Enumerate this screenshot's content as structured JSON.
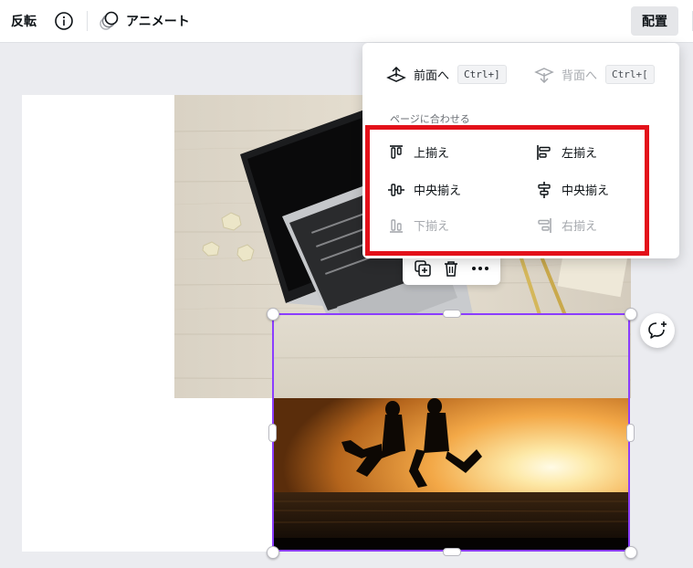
{
  "toolbar": {
    "flip_label": "反転",
    "animate_label": "アニメート",
    "position_label": "配置"
  },
  "position_panel": {
    "forward_label": "前面へ",
    "forward_shortcut": "Ctrl+]",
    "backward_label": "背面へ",
    "backward_shortcut": "Ctrl+[",
    "align_section_label": "ページに合わせる",
    "align_items": [
      {
        "label": "上揃え",
        "icon": "align-top-icon",
        "enabled": true
      },
      {
        "label": "左揃え",
        "icon": "align-left-icon",
        "enabled": true
      },
      {
        "label": "中央揃え",
        "icon": "align-middle-icon",
        "enabled": true
      },
      {
        "label": "中央揃え",
        "icon": "align-center-icon",
        "enabled": true
      },
      {
        "label": "下揃え",
        "icon": "align-bottom-icon",
        "enabled": false
      },
      {
        "label": "右揃え",
        "icon": "align-right-icon",
        "enabled": false
      }
    ]
  },
  "colors": {
    "selection": "#8b3dff",
    "highlight": "#e3111a",
    "disabled_text": "#a6a9ae"
  }
}
